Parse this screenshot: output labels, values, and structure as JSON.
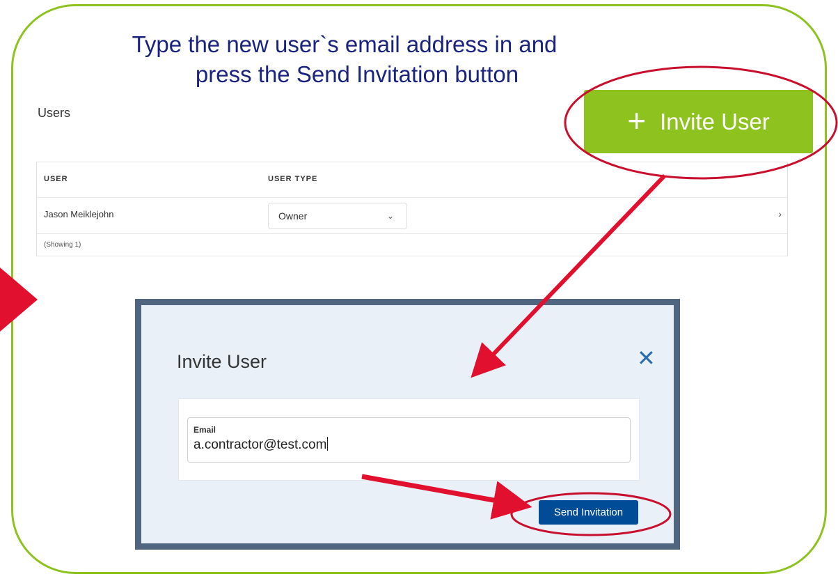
{
  "instruction": {
    "line1": "Type the new user`s email address in and",
    "line2": "press the Send Invitation button"
  },
  "page": {
    "title": "Users",
    "invite_button_label": "Invite User",
    "invite_button_icon": "plus-icon"
  },
  "table": {
    "columns": [
      "USER",
      "USER TYPE"
    ],
    "rows": [
      {
        "user": "Jason Meiklejohn",
        "user_type": "Owner"
      }
    ],
    "footer": "(Showing 1)"
  },
  "modal": {
    "title": "Invite User",
    "close_icon": "close-icon",
    "email_label": "Email",
    "email_value": "a.contractor@test.com",
    "send_button_label": "Send Invitation"
  },
  "colors": {
    "frame_green": "#8dc21f",
    "instruction_navy": "#1a237e",
    "annotation_red": "#e0102e",
    "highlight_ellipse": "#c8102e",
    "send_button_blue": "#004c97",
    "modal_border": "#4f6580"
  }
}
